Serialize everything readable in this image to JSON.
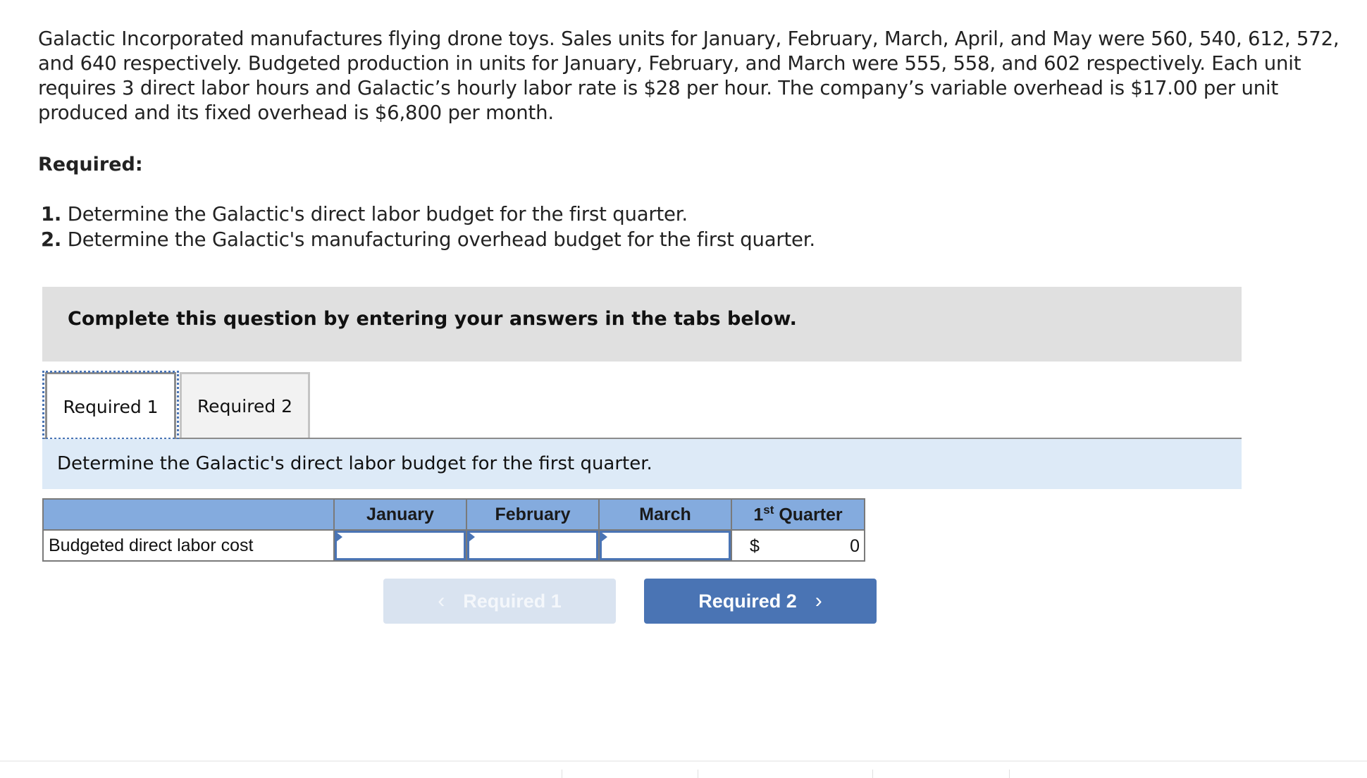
{
  "problem": {
    "intro": "Galactic Incorporated manufactures flying drone toys. Sales units for January, February, March, April, and May were 560, 540, 612, 572, and 640  respectively. Budgeted production in units for January, February, and March were 555, 558, and 602 respectively. Each unit requires 3 direct labor hours and Galactic’s hourly labor rate is $28 per hour. The company’s variable overhead is $17.00 per unit produced and its fixed overhead is $6,800 per month.",
    "required_heading": "Required:",
    "requirements": [
      {
        "num": "1.",
        "text": "Determine the Galactic's direct labor budget for the first quarter."
      },
      {
        "num": "2.",
        "text": "Determine the Galactic's manufacturing overhead budget for the first quarter."
      }
    ]
  },
  "instruction_box": "Complete this question by entering your answers in the tabs below.",
  "tabs": [
    {
      "label": "Required 1",
      "active": true
    },
    {
      "label": "Required 2",
      "active": false
    }
  ],
  "task_prompt": "Determine the Galactic's direct labor budget for the first quarter.",
  "table": {
    "headers": [
      "",
      "January",
      "February",
      "March",
      "1",
      "st",
      " Quarter"
    ],
    "rows": [
      {
        "label": "Budgeted direct labor cost",
        "january": "",
        "february": "",
        "march": "",
        "quarter_currency": "$",
        "quarter_value": "0"
      }
    ]
  },
  "nav": {
    "prev_label": "Required 1",
    "next_label": "Required 2",
    "prev_icon": "chevron-left-icon",
    "next_icon": "chevron-right-icon",
    "prev_chevron": "‹",
    "next_chevron": "›"
  },
  "colors": {
    "accent": "#4a74b4",
    "header_fill": "#84abde",
    "instruction_bg": "#e0e0e0",
    "task_bg": "#ddeaf7",
    "disabled_button": "#d9e3f0"
  }
}
